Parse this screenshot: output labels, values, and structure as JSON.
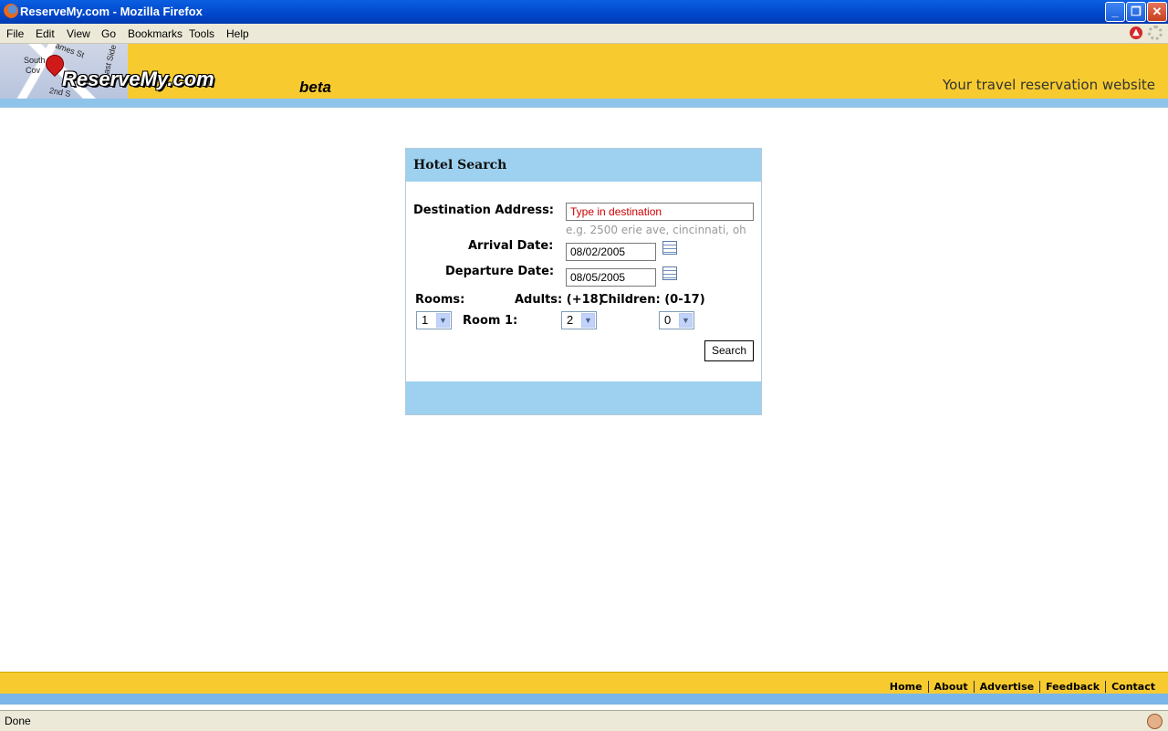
{
  "window": {
    "title": "ReserveMy.com - Mozilla Firefox"
  },
  "menu": {
    "items": [
      "File",
      "Edit",
      "View",
      "Go",
      "Bookmarks",
      "Tools",
      "Help"
    ]
  },
  "header": {
    "logo": "ReserveMy.com",
    "beta": "beta",
    "tagline": "Your travel reservation website",
    "map_labels": [
      "ames St",
      "South",
      "Cov",
      "2nd S",
      "ast Side"
    ]
  },
  "search": {
    "title": "Hotel Search",
    "destination_label": "Destination Address:",
    "destination_value": "Type in destination",
    "destination_hint": "e.g. 2500 erie ave, cincinnati, oh",
    "arrival_label": "Arrival Date:",
    "arrival_value": "08/02/2005",
    "departure_label": "Departure Date:",
    "departure_value": "08/05/2005",
    "rooms_label": "Rooms:",
    "adults_label": "Adults: (+18)",
    "children_label": "Children: (0-17)",
    "room1_label": "Room 1:",
    "rooms_value": "1",
    "adults_value": "2",
    "children_value": "0",
    "search_button": "Search"
  },
  "footer": {
    "links": [
      "Home",
      "About",
      "Advertise",
      "Feedback",
      "Contact"
    ]
  },
  "status": {
    "text": "Done"
  },
  "colors": {
    "header_yellow": "#f7cb2f",
    "band_blue": "#8ec3ea",
    "box_head_blue": "#9dd1ef",
    "destination_text": "#cc0000"
  }
}
